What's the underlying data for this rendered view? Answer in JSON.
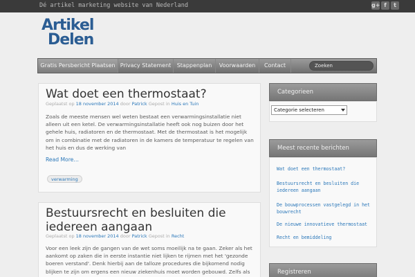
{
  "header": {
    "tagline": "Dé artikel marketing website van Nederland",
    "social": [
      {
        "icon": "google-plus-icon",
        "glyph": "g+"
      },
      {
        "icon": "facebook-icon",
        "glyph": "f"
      },
      {
        "icon": "twitter-icon",
        "glyph": "t"
      }
    ],
    "logo_line1": "Artikel",
    "logo_line2": "Delen"
  },
  "nav": {
    "items": [
      "Gratis Persbericht Plaatsen",
      "Privacy Statement",
      "Stappenplan",
      "Voorwaarden",
      "Contact"
    ],
    "search_placeholder": "Zoeken"
  },
  "posts": [
    {
      "title": "Wat doet een thermostaat?",
      "meta_prefix": "Geplaatst op",
      "date": "18 november 2014",
      "by": "door",
      "author": "Patrick",
      "posted_in": "Gepost in",
      "category": "Huis en Tuin",
      "excerpt": "Zoals de meeste mensen wel weten bestaat een verwarmingsinstallatie niet alleen uit een ketel. De verwarmingsinstallatie heeft ook nog buizen door het gehele huis, radiatoren en de thermostaat. Met de thermostaat is het mogelijk om in combinatie met de radiatoren in de kamers de temperatuur te regelen van het huis en dus de werking van",
      "read_more": "Read More…",
      "tag": "verwarming"
    },
    {
      "title": "Bestuursrecht en besluiten die iedereen aangaan",
      "meta_prefix": "Geplaatst op",
      "date": "18 november 2014",
      "by": "door",
      "author": "Patrick",
      "posted_in": "Gepost in",
      "category": "Recht",
      "excerpt": "Voor een leek zijn de gangen van de wet soms moeilijk na te gaan. Zeker als het aankomt op zaken die in eerste instantie niet lijken te rijmen met het 'gezonde boeren verstand'. Denk hierbij aan de talloze procedures die bijkomend nodig blijken te zijn om ergens een nieuw ziekenhuis moet worden gebouwd. Zelfs als"
    }
  ],
  "sidebar": {
    "categories_title": "Categorieen",
    "categories_select": "Categorie selecteren",
    "recent_title": "Meest recente berichten",
    "recent": [
      "Wat doet een thermostaat?",
      "Bestuursrecht en besluiten die iedereen aangaan",
      "De bouwprocessen vastgelegd in het bouwrecht",
      "De nieuwe innovatieve thermostaat",
      "Recht en bemiddeling"
    ],
    "register_title": "Registreren"
  }
}
